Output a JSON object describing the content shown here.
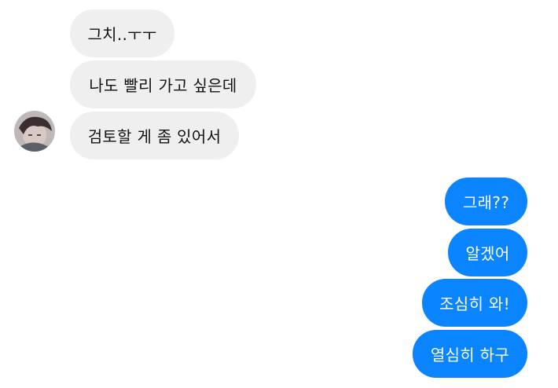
{
  "conversation": {
    "received": [
      {
        "text": "그치..ㅜㅜ"
      },
      {
        "text": "나도 빨리 가고 싶은데"
      },
      {
        "text": "검토할 게 좀 있어서"
      }
    ],
    "sent": [
      {
        "text": "그래??"
      },
      {
        "text": "알겠어"
      },
      {
        "text": "조심히 와!"
      },
      {
        "text": "열심히 하구"
      }
    ]
  },
  "colors": {
    "received_bubble": "#efefef",
    "sent_bubble": "#0a84ff",
    "background": "#ffffff"
  }
}
